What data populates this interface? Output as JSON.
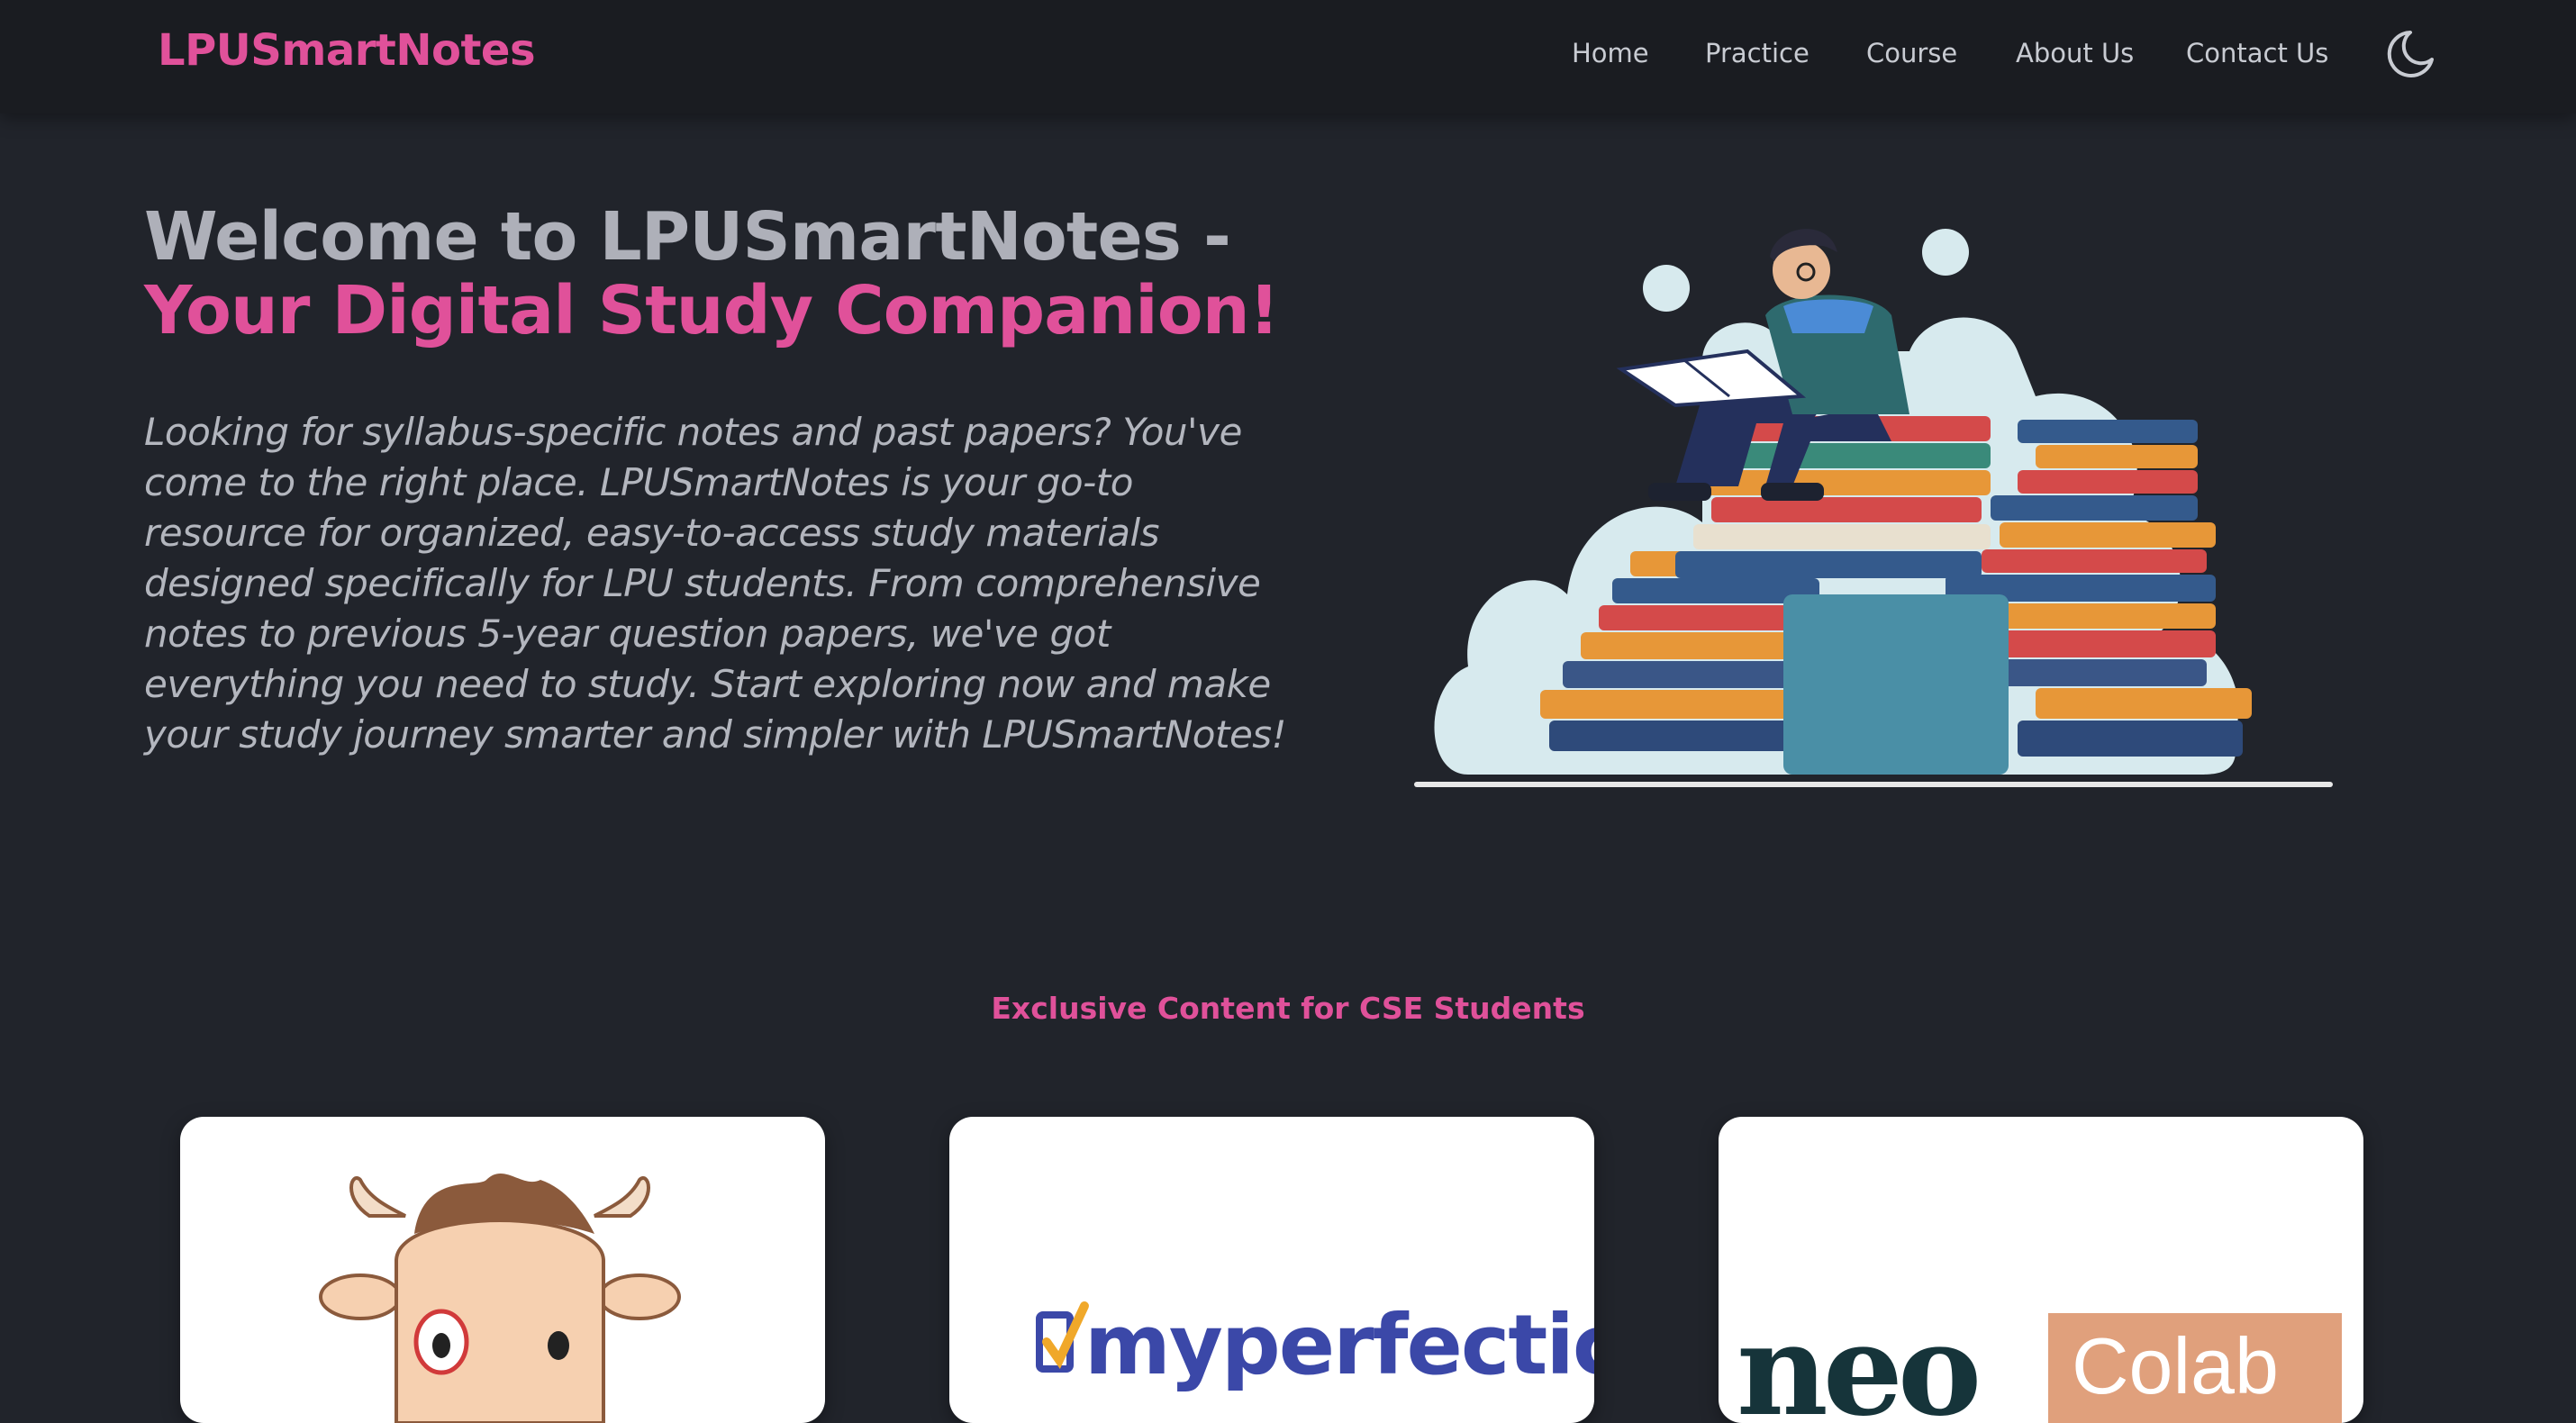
{
  "navbar": {
    "brand": "LPUSmartNotes",
    "links": [
      {
        "label": "Home"
      },
      {
        "label": "Practice"
      },
      {
        "label": "Course"
      },
      {
        "label": "About Us"
      },
      {
        "label": "Contact Us"
      }
    ],
    "theme_toggle_icon": "moon-icon"
  },
  "hero": {
    "title_part1": "Welcome to LPUSmartNotes - ",
    "title_part2": "Your Digital Study Companion!",
    "description": "Looking for syllabus-specific notes and past papers? You've come to the right place. LPUSmartNotes is your go-to resource for organized, easy-to-access study materials designed specifically for LPU students. From comprehensive notes to previous 5-year question papers, we've got everything you need to study. Start exploring now and make your study journey smarter and simpler with LPUSmartNotes!",
    "illustration": "student-reading-on-books-illustration"
  },
  "section": {
    "title": "Exclusive Content for CSE Students",
    "cards": [
      {
        "logo": "cartoon-bull-logo"
      },
      {
        "logo_text": "myperfectice"
      },
      {
        "logo_text_left": "neo",
        "logo_text_right": "Colab"
      }
    ]
  },
  "colors": {
    "accent": "#e0519a",
    "background": "#21242b",
    "navbar": "#1a1c21",
    "text": "#b3b6be"
  }
}
